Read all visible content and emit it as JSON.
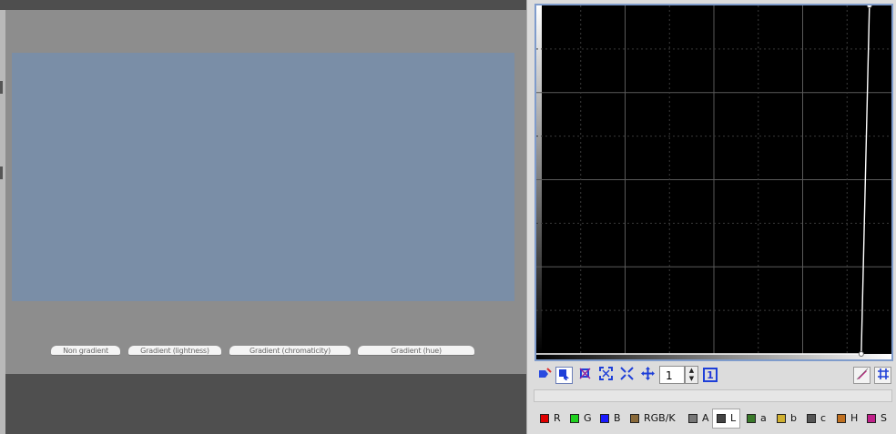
{
  "preview": {
    "buttons": [
      {
        "label": "Non gradient"
      },
      {
        "label": "Gradient (lightness)"
      },
      {
        "label": "Gradient (chromaticity)"
      },
      {
        "label": "Gradient (hue)"
      }
    ],
    "swatch_color": "#7a8ea7"
  },
  "curve": {
    "points": [
      [
        0.0,
        0.0
      ],
      [
        0.915,
        0.0
      ],
      [
        0.938,
        1.0
      ]
    ],
    "grid_divisions": 4,
    "line_color": "#ffffff",
    "background": "#000000",
    "frame_color": "#7f9ccc"
  },
  "toolbar": {
    "tools": [
      {
        "icon": "curve-edit-icon"
      },
      {
        "icon": "select-point-icon"
      },
      {
        "icon": "delete-point-icon"
      },
      {
        "icon": "zoom-in-icon"
      },
      {
        "icon": "zoom-out-icon"
      },
      {
        "icon": "pan-icon"
      }
    ],
    "spin_value": "1",
    "one_label": "1",
    "right_tools": [
      {
        "icon": "draw-icon"
      },
      {
        "icon": "grid-icon"
      }
    ]
  },
  "channels": [
    {
      "label": "R",
      "color": "#e00000"
    },
    {
      "label": "G",
      "color": "#1fd11f"
    },
    {
      "label": "B",
      "color": "#1a1aff"
    },
    {
      "label": "RGB/K",
      "color": "#8a6a3a"
    },
    {
      "label": "A",
      "color": "#777777"
    },
    {
      "label": "L",
      "color": "#444444",
      "active": true
    },
    {
      "label": "a",
      "color": "#3a7a2a"
    },
    {
      "label": "b",
      "color": "#d0b030"
    },
    {
      "label": "c",
      "color": "#555555"
    },
    {
      "label": "H",
      "color": "#c07020"
    },
    {
      "label": "S",
      "color": "#c0208a"
    }
  ]
}
